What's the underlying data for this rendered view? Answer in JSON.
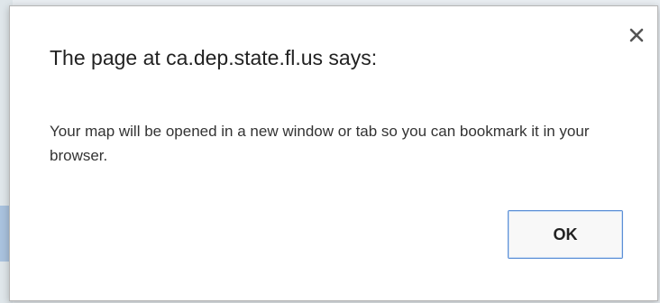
{
  "dialog": {
    "title": "The page at ca.dep.state.fl.us says:",
    "message": "Your map will be opened in a new window or tab so you can bookmark it in your browser.",
    "close_icon": "close-icon",
    "ok_label": "OK"
  },
  "colors": {
    "dialog_background": "#ffffff",
    "button_border": "#5c8fd6",
    "title_text": "#222222",
    "body_text": "#333333"
  }
}
